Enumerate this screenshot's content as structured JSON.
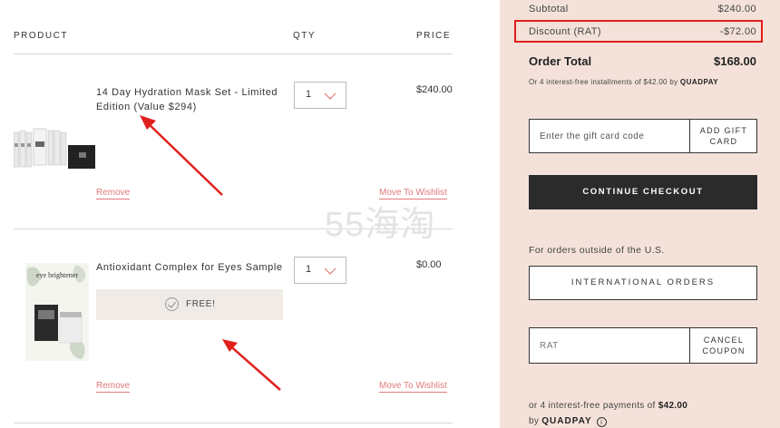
{
  "cart": {
    "headers": {
      "product": "PRODUCT",
      "qty": "QTY",
      "price": "PRICE"
    },
    "items": [
      {
        "name": "14 Day Hydration Mask Set - Limited Edition (Value $294)",
        "qty": "1",
        "price": "$240.00",
        "remove_label": "Remove",
        "wishlist_label": "Move To Wishlist"
      },
      {
        "name": "Antioxidant Complex for Eyes Sample",
        "qty": "1",
        "price": "$0.00",
        "free_label": "FREE!",
        "remove_label": "Remove",
        "wishlist_label": "Move To Wishlist",
        "package_text": "eye brightener"
      }
    ],
    "watermark": "55海淘"
  },
  "summary": {
    "subtotal_label": "Subtotal",
    "subtotal_value": "$240.00",
    "discount_label": "Discount (RAT)",
    "discount_value": "-$72.00",
    "order_total_label": "Order Total",
    "order_total_value": "$168.00",
    "installments_text": "Or 4 interest-free installments of $42.00 by",
    "quadpay_brand": "QUADPAY",
    "gift_card_placeholder": "Enter the gift card code",
    "add_gift_card_label": "ADD GIFT CARD",
    "continue_checkout_label": "CONTINUE CHECKOUT",
    "outside_us_text": "For orders outside of the U.S.",
    "international_orders_label": "INTERNATIONAL ORDERS",
    "coupon_value": "RAT",
    "cancel_coupon_label": "CANCEL COUPON",
    "payments_text_prefix": "or 4 interest-free payments of",
    "payments_amount": "$42.00",
    "payments_by": "by",
    "quadpay_brand_2": "QUADPAY"
  },
  "colors": {
    "accent_link": "#e07a78",
    "highlight_box": "#e0201c",
    "summary_bg": "#f4e2da",
    "checkout_bg": "#2b2b2b"
  }
}
